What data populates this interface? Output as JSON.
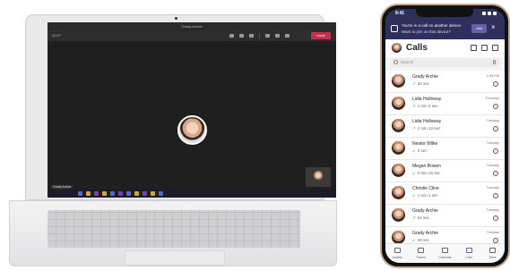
{
  "laptop": {
    "window_title": "Grady Archie",
    "call_timer": "00:07",
    "leave_label": "Leave",
    "participant_name": "Grady Archie"
  },
  "phone": {
    "status_time": "9:41",
    "banner": {
      "line1": "You're in a call on another device",
      "line2": "Want to join on this device?",
      "join_label": "Join",
      "close_glyph": "×"
    },
    "header_title": "Calls",
    "search_placeholder": "Search",
    "calls": [
      {
        "name": "Grady Archie",
        "duration": "34 sec",
        "date": "2:35 PM"
      },
      {
        "name": "Lidia Holloway",
        "duration": "1 min 4 sec",
        "date": "Thursday"
      },
      {
        "name": "Lidia Holloway",
        "duration": "1 min 13 sec",
        "date": "Tuesday"
      },
      {
        "name": "Nestor Wilke",
        "duration": "2 sec",
        "date": "Tuesday"
      },
      {
        "name": "Megan Bowen",
        "duration": "2 min 16 sec",
        "date": "Tuesday"
      },
      {
        "name": "Christie Cline",
        "duration": "1 min 1 sec",
        "date": "Tuesday"
      },
      {
        "name": "Grady Archie",
        "duration": "51 sec",
        "date": "Tuesday"
      },
      {
        "name": "Grady Archie",
        "duration": "40 sec",
        "date": "Tuesday"
      }
    ],
    "nav": [
      {
        "label": "Activity",
        "icon": "bell-icon"
      },
      {
        "label": "Teams",
        "icon": "teams-icon"
      },
      {
        "label": "Calendar",
        "icon": "calendar-icon"
      },
      {
        "label": "Calls",
        "icon": "phone-icon",
        "active": true
      },
      {
        "label": "More",
        "icon": "more-icon"
      }
    ],
    "accent_color": "#6264a7",
    "banner_color": "#2e2f5b"
  }
}
